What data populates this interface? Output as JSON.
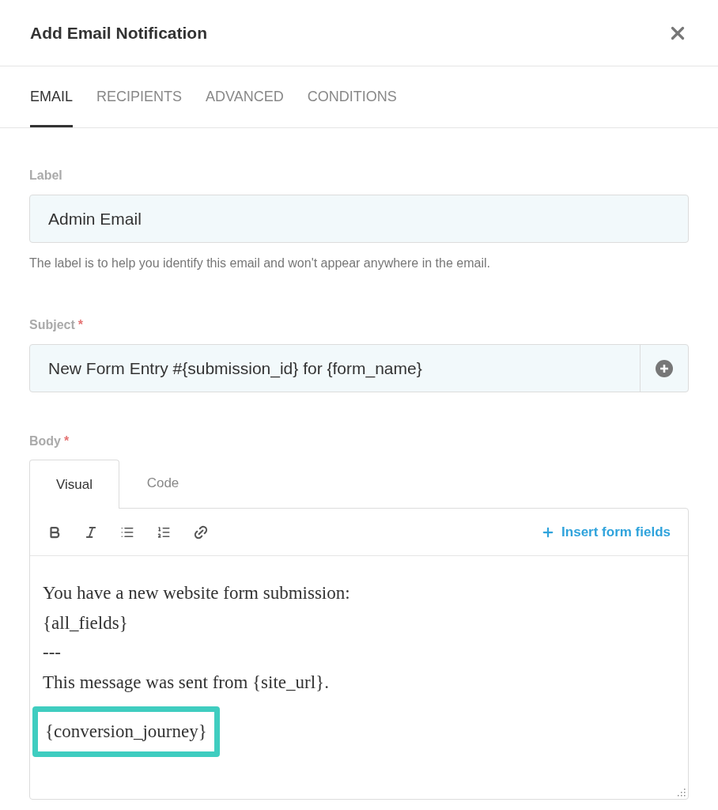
{
  "window": {
    "title": "Add Email Notification"
  },
  "tabs": [
    {
      "label": "EMAIL",
      "selected": true
    },
    {
      "label": "RECIPIENTS",
      "selected": false
    },
    {
      "label": "ADVANCED",
      "selected": false
    },
    {
      "label": "CONDITIONS",
      "selected": false
    }
  ],
  "label_field": {
    "label": "Label",
    "value": "Admin Email",
    "help": "The label is to help you identify this email and won't appear anywhere in the email."
  },
  "subject_field": {
    "label": "Subject",
    "required_mark": "*",
    "value": "New Form Entry #{submission_id} for {form_name}"
  },
  "body": {
    "label": "Body",
    "required_mark": "*",
    "editor_tabs": [
      {
        "label": "Visual",
        "selected": true
      },
      {
        "label": "Code",
        "selected": false
      }
    ],
    "insert_button": "Insert form fields",
    "lines": [
      {
        "text": "You have a new website form submission:",
        "highlighted": false
      },
      {
        "text": "{all_fields}",
        "highlighted": false
      },
      {
        "text": "---",
        "highlighted": false
      },
      {
        "text": "This message was sent from {site_url}.",
        "highlighted": false
      },
      {
        "text": "{conversion_journey}",
        "highlighted": true
      }
    ]
  }
}
